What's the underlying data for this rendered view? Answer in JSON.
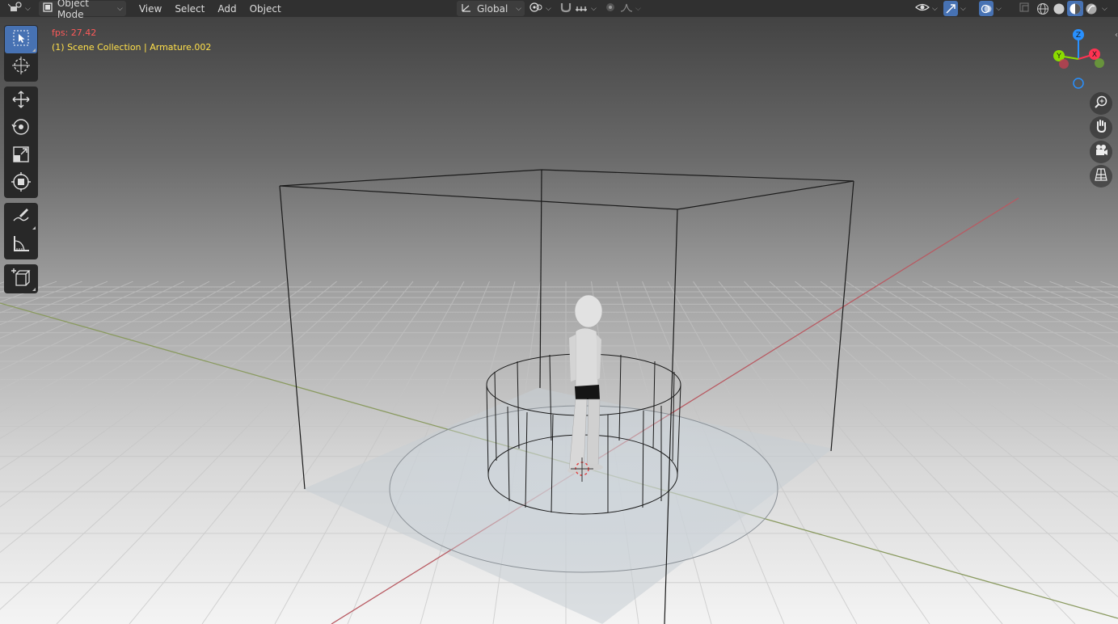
{
  "header": {
    "mode_label": "Object Mode",
    "menus": [
      "View",
      "Select",
      "Add",
      "Object"
    ],
    "orientation_label": "Global"
  },
  "overlay": {
    "fps": "fps: 27.42",
    "collection": "(1) Scene Collection | Armature.002"
  },
  "gizmo": {
    "z_label": "Z",
    "y_label": "Y",
    "x_label": "X"
  },
  "colors": {
    "header_bg": "#303030",
    "accent": "#4772b3",
    "fps_text": "#ff5a5a",
    "collection_text": "#ffe04a",
    "axis_x": "#ff3352",
    "axis_y": "#8bdc00",
    "axis_z": "#2890ff"
  },
  "toolbar": {
    "tools": [
      "select-box-icon",
      "cursor-icon",
      "move-icon",
      "rotate-icon",
      "scale-icon",
      "transform-icon",
      "annotate-icon",
      "measure-icon",
      "add-cube-icon"
    ]
  },
  "nav": {
    "buttons": [
      "zoom-icon",
      "pan-hand-icon",
      "camera-icon",
      "grid-view-icon"
    ]
  }
}
